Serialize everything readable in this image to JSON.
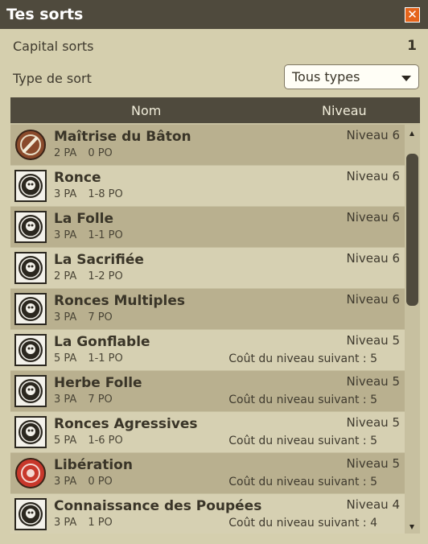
{
  "window": {
    "title": "Tes sorts",
    "close_glyph": "✕"
  },
  "capital": {
    "label": "Capital sorts",
    "value": "1"
  },
  "type_filter": {
    "label": "Type de sort",
    "selected": "Tous types"
  },
  "columns": {
    "name": "Nom",
    "level": "Niveau"
  },
  "spells": [
    {
      "name": "Maîtrise du Bâton",
      "pa": "2 PA",
      "po": "0 PO",
      "level": "Niveau 6",
      "next": "",
      "icon": "staff-icon"
    },
    {
      "name": "Ronce",
      "pa": "3 PA",
      "po": "1-8 PO",
      "level": "Niveau 6",
      "next": "",
      "icon": "bramble-icon"
    },
    {
      "name": "La Folle",
      "pa": "3 PA",
      "po": "1-1 PO",
      "level": "Niveau 6",
      "next": "",
      "icon": "mad-plant-icon"
    },
    {
      "name": "La Sacrifiée",
      "pa": "2 PA",
      "po": "1-2 PO",
      "level": "Niveau 6",
      "next": "",
      "icon": "sacrificed-icon"
    },
    {
      "name": "Ronces Multiples",
      "pa": "3 PA",
      "po": "7 PO",
      "level": "Niveau 6",
      "next": "",
      "icon": "multiple-brambles-icon"
    },
    {
      "name": "La Gonflable",
      "pa": "5 PA",
      "po": "1-1 PO",
      "level": "Niveau 5",
      "next": "Coût du niveau suivant : 5",
      "icon": "inflatable-icon"
    },
    {
      "name": "Herbe Folle",
      "pa": "3 PA",
      "po": "7 PO",
      "level": "Niveau 5",
      "next": "Coût du niveau suivant : 5",
      "icon": "wild-grass-icon"
    },
    {
      "name": "Ronces Agressives",
      "pa": "5 PA",
      "po": "1-6 PO",
      "level": "Niveau 5",
      "next": "Coût du niveau suivant : 5",
      "icon": "aggressive-brambles-icon"
    },
    {
      "name": "Libération",
      "pa": "3 PA",
      "po": "0 PO",
      "level": "Niveau 5",
      "next": "Coût du niveau suivant : 5",
      "icon": "liberation-icon"
    },
    {
      "name": "Connaissance des Poupées",
      "pa": "3 PA",
      "po": "1 PO",
      "level": "Niveau 4",
      "next": "Coût du niveau suivant : 4",
      "icon": "doll-knowledge-icon"
    }
  ],
  "colors": {
    "header": "#4f4a3d",
    "panel": "#d5cfae",
    "row_dark": "#b9b08f",
    "row_light": "#d6d0b2",
    "close": "#e5641b"
  }
}
